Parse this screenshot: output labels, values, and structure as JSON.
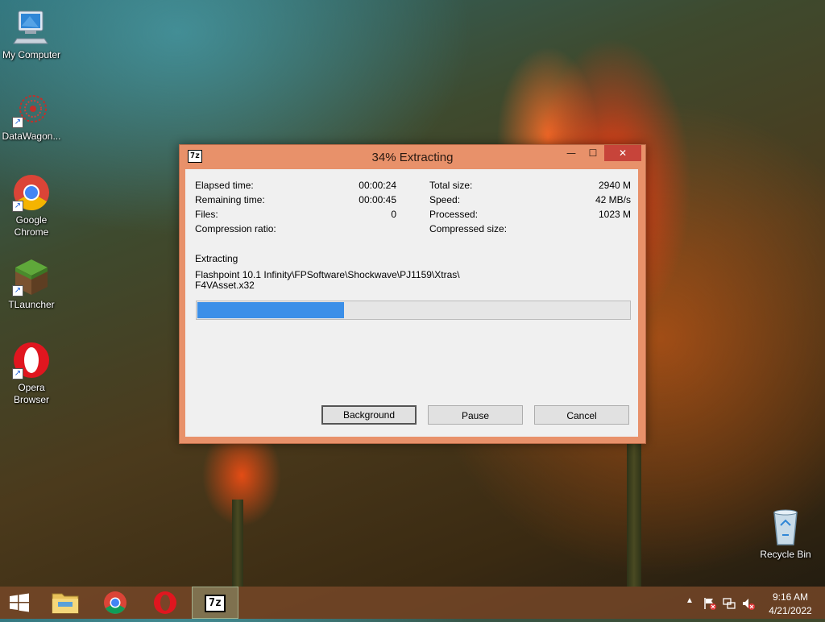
{
  "desktop": {
    "icons": [
      {
        "label": "My Computer"
      },
      {
        "label": "DataWagon..."
      },
      {
        "label": "Google Chrome"
      },
      {
        "label": "TLauncher"
      },
      {
        "label": "Opera Browser"
      },
      {
        "label": "Recycle Bin"
      }
    ]
  },
  "dialog": {
    "app_icon": "7z",
    "title": "34% Extracting",
    "controls": {
      "minimize": "—",
      "maximize": "☐",
      "close": "✕"
    },
    "stats_left": [
      {
        "label": "Elapsed time:",
        "value": "00:00:24"
      },
      {
        "label": "Remaining time:",
        "value": "00:00:45"
      },
      {
        "label": "Files:",
        "value": "0"
      },
      {
        "label": "Compression ratio:",
        "value": ""
      }
    ],
    "stats_right": [
      {
        "label": "Total size:",
        "value": "2940 M"
      },
      {
        "label": "Speed:",
        "value": "42 MB/s"
      },
      {
        "label": "Processed:",
        "value": "1023 M"
      },
      {
        "label": "Compressed size:",
        "value": ""
      }
    ],
    "operation": "Extracting",
    "path_line1": "Flashpoint 10.1 Infinity\\FPSoftware\\Shockwave\\PJ1159\\Xtras\\",
    "path_line2": "F4VAsset.x32",
    "progress_fraction": 0.34,
    "buttons": {
      "background": "Background",
      "pause": "Pause",
      "cancel": "Cancel"
    }
  },
  "taskbar": {
    "pinned": [
      {
        "name": "start",
        "icon": "windows-logo"
      },
      {
        "name": "file-explorer",
        "icon": "folder-icon"
      },
      {
        "name": "chrome",
        "icon": "chrome-icon"
      },
      {
        "name": "opera",
        "icon": "opera-icon"
      },
      {
        "name": "7zip",
        "icon": "7zip-icon",
        "label": "7z"
      }
    ],
    "tray": {
      "time": "9:16 AM",
      "date": "4/21/2022"
    }
  }
}
